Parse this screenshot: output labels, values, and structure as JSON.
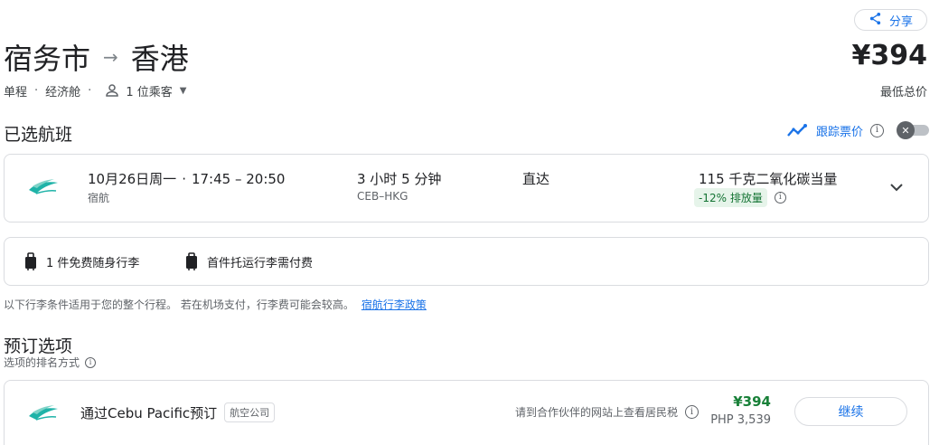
{
  "share": {
    "label": "分享",
    "icon": "share-icon"
  },
  "route": {
    "origin": "宿务市",
    "arrow": "→",
    "destination": "香港"
  },
  "trip_meta": {
    "trip_type": "单程",
    "separator": "·",
    "cabin": "经济舱",
    "passengers": "1 位乘客"
  },
  "price": {
    "amount": "¥394",
    "label": "最低总价"
  },
  "selected_section": {
    "title": "已选航班"
  },
  "tracking": {
    "label": "跟踪票价",
    "toggle_on": false
  },
  "flight": {
    "date": "10月26日周一",
    "separator": "·",
    "times": "17:45 – 20:50",
    "airline": "宿航",
    "duration": "3 小时 5 分钟",
    "airports": "CEB–HKG",
    "stops": "直达",
    "emissions": "115 千克二氧化碳当量",
    "emission_badge": "-12% 排放量"
  },
  "baggage": {
    "carry_on": "1 件免费随身行李",
    "checked": "首件托运行李需付费",
    "note": "以下行李条件适用于您的整个行程。 若在机场支付，行李费可能会较高。",
    "policy_link": "宿航行李政策"
  },
  "booking": {
    "title": "预订选项",
    "sort_note": "选项的排名方式",
    "option": {
      "via_text": "通过Cebu Pacific预订",
      "tag": "航空公司",
      "tax_note": "请到合作伙伴的网站上查看居民税",
      "price": "¥394",
      "price_local": "PHP 3,539",
      "continue": "继续"
    }
  },
  "colors": {
    "accent": "#1a73e8",
    "price_green": "#188038",
    "emission_bg": "#e6f4ea",
    "logo_teal": "#1fb3a8"
  }
}
